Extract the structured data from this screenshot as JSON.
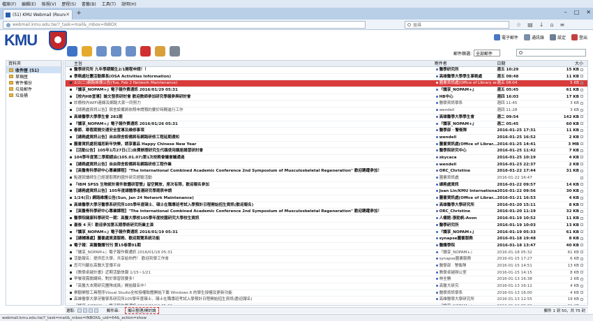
{
  "browser": {
    "menu": [
      "檔案(F)",
      "編輯(E)",
      "檢視(V)",
      "歷程(S)",
      "書籤(B)",
      "工具(T)",
      "說明(H)"
    ],
    "tab_title": "(51) KMU Webmail (Round-",
    "url": "webmail.kmu.edu.tw/?_task=mail&_mbox=INBOX",
    "search_placeholder": "搜尋",
    "status_url": "webmail.kmu.edu.tw/?_task=mail&_mbox=INBOX&_uid=64&_action=show"
  },
  "header": {
    "logo_text": "KMU",
    "links": [
      {
        "label": "電子郵件",
        "icon": "mail-icon",
        "color": "#4a78c2"
      },
      {
        "label": "通訊錄",
        "icon": "addressbook-icon",
        "color": "#7a8fa8"
      },
      {
        "label": "設定",
        "icon": "settings-icon",
        "color": "#6d7f95"
      },
      {
        "label": "登出",
        "icon": "logout-icon",
        "color": "#c34040"
      }
    ],
    "filter_label": "郵件篩選:",
    "filter_value": "全部郵件"
  },
  "toolbar": [
    {
      "icon": "check-mail-icon",
      "color": "#3e73c8"
    },
    {
      "icon": "compose-icon",
      "color": "#e5a92b"
    },
    {
      "icon": "reply-icon",
      "color": "#6b8fc7"
    },
    {
      "icon": "reply-all-icon",
      "color": "#6b8fc7"
    },
    {
      "icon": "forward-icon",
      "color": "#6b8fc7"
    },
    {
      "icon": "delete-icon",
      "color": "#d0302f"
    },
    {
      "icon": "mark-icon",
      "color": "#d9a03a"
    },
    {
      "icon": "more-actions-icon",
      "color": "#7d8794"
    }
  ],
  "folders": {
    "title": "資料夾",
    "items": [
      {
        "label": "收件匣 (51)",
        "selected": true
      },
      {
        "label": "草稿匣"
      },
      {
        "label": "寄件備份"
      },
      {
        "label": "垃圾郵件"
      },
      {
        "label": "垃圾桶"
      }
    ]
  },
  "list": {
    "columns": {
      "subject": "主旨",
      "from": "寄件者",
      "date": "日期",
      "size": "大小"
    },
    "rows": [
      {
        "subject": "醫學研究所 九年學期類生2/1開程申請！！",
        "from": "醫學研究所",
        "date": "週五 10:29",
        "size": "15 KB",
        "state": "unread"
      },
      {
        "subject": "學務處社團活動課長(OSA Activities Information)",
        "from": "高雄醫學大學學生事務處",
        "date": "週五 08:48",
        "size": "11 KB",
        "state": "unread"
      },
      {
        "subject": "2/2(二)網路維護公告(Tue, Feb 2 Network Maintenance)",
        "from": "圖書資訊處(Office of Library an...",
        "date": "週五 08:04",
        "size": "5 KB",
        "state": "sel"
      },
      {
        "subject": "『讀享_NOPAM+』電子報作費通訊 2016/01/29 05:31",
        "from": "『讀享_NOPAM+』",
        "date": "週五 05:45",
        "size": "61 KB",
        "state": "unread"
      },
      {
        "subject": "【校內HB宣導】論文發表研討會 歡迎教師參加研究學報參與研討會",
        "from": "HB中心",
        "date": "週四 16:03",
        "size": "17 KB",
        "state": "unread"
      },
      {
        "subject": "診療校內WIFI連線及網路大家一同努力",
        "from": "醫學資訊學系",
        "date": "週四 11:45",
        "size": "3 KB",
        "state": "read"
      },
      {
        "subject": "【總務處資訊公告】宿舍設備將依照申請預約要於時間進行工作",
        "from": "wendell",
        "date": "週四 11:28",
        "size": "3 KB",
        "state": "read"
      },
      {
        "subject": "高雄醫學大學學生會 281期",
        "from": "高雄醫學大學學生會",
        "date": "週二 09:54",
        "size": "142 KB",
        "state": "unread"
      },
      {
        "subject": "『讀享_NOPAM+』電子報作費通訊 2016/01/26 05:31",
        "from": "『讀享_NOPAM+』",
        "date": "週二 05:45",
        "size": "60 KB",
        "state": "unread"
      },
      {
        "subject": "春節、寒假期間交通安全宣導及維修事項",
        "from": "醫學部 · 警衛隊",
        "date": "2016-01-25 17:31",
        "size": "11 KB",
        "state": "unread"
      },
      {
        "subject": "【總務處資訊公告】自由宿舍設備將有網路研修工程延期通知",
        "from": "wendell",
        "date": "2016-01-25 16:52",
        "size": "2 KB",
        "state": "unread"
      },
      {
        "subject": "圖書資訊處祝福您新年快樂，請享書品 Happy Chinese New Year",
        "from": "圖書資訊處(Office of Librar...",
        "date": "2016-01-25 14:41",
        "size": "3 MB",
        "state": "unread"
      },
      {
        "subject": "【活動公告】105年1月27日(三)自費辦理研究生代碼使用講座講習研討會",
        "from": "醫學院研究中心",
        "date": "2016-01-25 11:42",
        "size": "7 KB",
        "state": "unread"
      },
      {
        "subject": "104學年度第二學期經由(105.01.07)第1次校務會議會議通過",
        "from": "skycaca",
        "date": "2016-01-25 10:19",
        "size": "4 KB",
        "state": "unread"
      },
      {
        "subject": "【總務處資訊公告】自由宿舍設備將有網路研修工程作業",
        "from": "wendell",
        "date": "2016-01-23 22:37",
        "size": "2 KB",
        "state": "unread"
      },
      {
        "subject": "【高醫骨科學研中心專業課程】\"The International Combined Academic Conference 2nd Symposium of Musculoskeletal Regeneration\" 歡迎踴躍參加！",
        "from": "ORC_Christine",
        "date": "2016-01-22 17:44",
        "size": "31 KB",
        "state": "unread"
      },
      {
        "subject": "點選就讀師生已經選取期的國外研究經驗活動",
        "from": "圖書資訊處",
        "date": "2016-01-22 16:47",
        "size": "",
        "state": "read"
      },
      {
        "subject": "『IBM SPSS 生物統計套件軟體研習營』留空開放，席次有限，歡迎報名參加",
        "from": "總務處資訊",
        "date": "2016-01-22 09:57",
        "size": "14 KB",
        "state": "unread"
      },
      {
        "subject": "【總務處資訊公告】105年度總體學者選研究學期表申請",
        "from": "Joan Lin/KMU International",
        "date": "2016-01-22 09:56",
        "size": "30 KB",
        "state": "unread"
      },
      {
        "subject": "1/24(日) 網路維護公告(Sun, Jan 24 Network Maintenance)",
        "from": "圖書資訊處(Office of Librar...",
        "date": "2016-01-21 16:53",
        "size": "4 KB",
        "state": "unread"
      },
      {
        "subject": "高雄醫學大學牙醫學系研究所105學年度碩士、碩士在職專班考試入學預計日程開始招生資訊(歡迎報名)",
        "from": "高雄醫學大學研究所",
        "date": "2016-01-20 15:11",
        "size": "8 KB",
        "state": "unread"
      },
      {
        "subject": "【高醫骨科學研中心專業課程】\"The International Combined Academic Conference 2nd Symposium of Musculoskeletal Regeneration\" 歡迎踴躍參加！",
        "from": "ORC_Christine",
        "date": "2016-01-20 11:19",
        "size": "32 KB",
        "state": "unread"
      },
      {
        "subject": "醫學院健康科學研究一期：高醫大學校105學年度校園研究大學校生資訊",
        "from": "人權館-張勁帆-Avon",
        "date": "2016-01-19 10:52",
        "size": "11 KB",
        "state": "unread"
      },
      {
        "subject": "最後 4 天！歡迎參加第五期學術研究所業主演",
        "from": "醫學研究所",
        "date": "2016-01-19 10:03",
        "size": "13 KB",
        "state": "unread"
      },
      {
        "subject": "『讀享_NOPAM+』電子報作費通訊 2016/01/19 05:31",
        "from": "『讀享_NOPAM+』",
        "date": "2016-01-19 05:33",
        "size": "61 KB",
        "state": "unread"
      },
      {
        "subject": "【總輔導處】圖書處資源服務、歡迎閱覽系統功能",
        "from": "synapse圖書服務",
        "date": "2016-01-18 19:48",
        "size": "8 KB",
        "state": "unread"
      },
      {
        "subject": "電子報：高醫醫護刊刊 第15卷第01期",
        "from": "醫護學院",
        "date": "2016-01-18 13:47",
        "size": "40 KB",
        "state": "unread"
      },
      {
        "subject": "『讀享_NOPAM+』電子報作費通訊 2016/01/18 05:31",
        "from": "『讀享_NOPAM+』",
        "date": "2016-01-18 05:32",
        "size": "61 KB",
        "state": "read"
      },
      {
        "subject": "活動報名：提供您大學，共享給你們！ 歡迎到學工作會",
        "from": "synapse圖書服務",
        "date": "2016-01-15 17:27",
        "size": "6 KB",
        "state": "read"
      },
      {
        "subject": "您可刊載在高醫大宣傳平台",
        "from": "醫學部 · 警衛隊",
        "date": "2016-01-15 14:51",
        "size": "13 KB",
        "state": "read"
      },
      {
        "subject": "《教學卓越計畫》近期活動快報 1/15~1/21",
        "from": "教學卓越辦公室",
        "date": "2016-01-15 14:15",
        "size": "8 KB",
        "state": "read"
      },
      {
        "subject": "早餐夜需關講時，對於學習就要多！",
        "from": "林全勝",
        "date": "2016-01-13 16:38",
        "size": "2 KB",
        "state": "read"
      },
      {
        "subject": "『高醫大本期研究團隊成員』開始報名中！",
        "from": "高醫大研究",
        "date": "2016-01-13 16:12",
        "size": "4 KB",
        "state": "read"
      },
      {
        "subject": "樂觀開發工具程序Visual Studio全校授權軟體開始下載 Windows 8 的學生授權及更新功能",
        "from": "醫學資訊學系",
        "date": "2016-01-13 16:00",
        "size": "4 KB",
        "state": "read"
      },
      {
        "subject": "高雄醫學大學牙醫學系研究所105學年度碩士、碩士在職專班考試入學預計日程開始招生資訊(歡迎報名)",
        "from": "高雄醫學大學研究所",
        "date": "2016-01-13 12:55",
        "size": "19 KB",
        "state": "read"
      },
      {
        "subject": "『讀享_NOPAM+』電子報作費通訊 2016/01/12 05:32",
        "from": "『讀享_NOPAM+』",
        "date": "2016-01-12 05:32",
        "size": "61 KB",
        "state": "read"
      }
    ]
  },
  "pager": {
    "label": "選取:",
    "threads": "顯示整理/開討論",
    "threads_prefix": "郵件串:",
    "info": "郵件 1 到 50，共 75 封"
  }
}
